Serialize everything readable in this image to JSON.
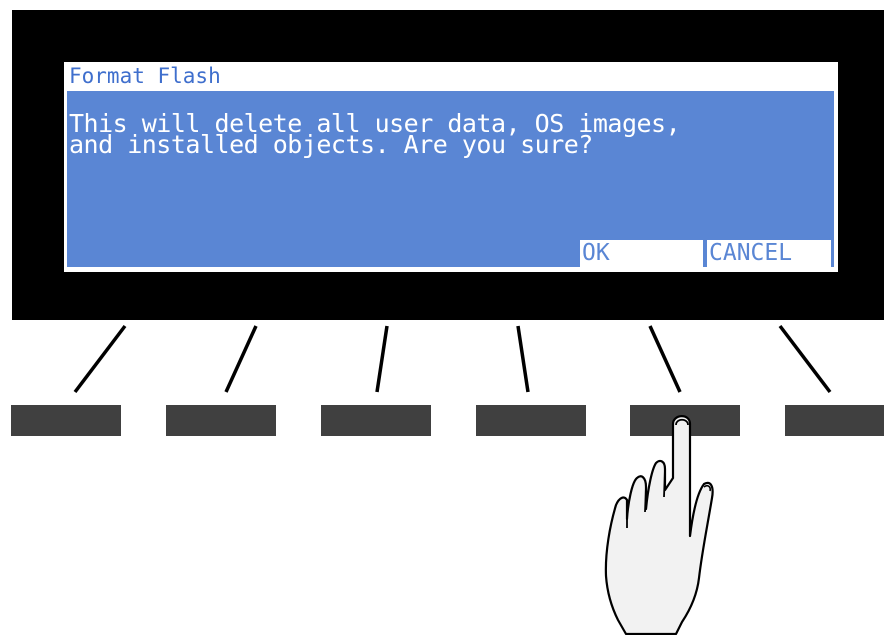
{
  "colors": {
    "bezel": "#000000",
    "screen_background": "#ffffff",
    "dialog_background": "#5a86d4",
    "title_text": "#3f6fcd",
    "dialog_text": "#ffffff",
    "softkey_label_text": "#5a86d4",
    "soft_button": "#404040",
    "hand_fill": "#f2f2f2",
    "hand_outline": "#000000",
    "leader_lines": "#000000"
  },
  "screen": {
    "title": "Format Flash"
  },
  "dialog": {
    "message_line_1": "This will delete all user data, OS images,",
    "message_line_2": "and installed objects. Are you sure?"
  },
  "softkeys": {
    "ok_label": "OK",
    "cancel_label": "CANCEL"
  },
  "soft_buttons": {
    "count": 6,
    "pressed_index": 5
  },
  "icons": {
    "pointer": "hand-pointing-finger-icon"
  }
}
